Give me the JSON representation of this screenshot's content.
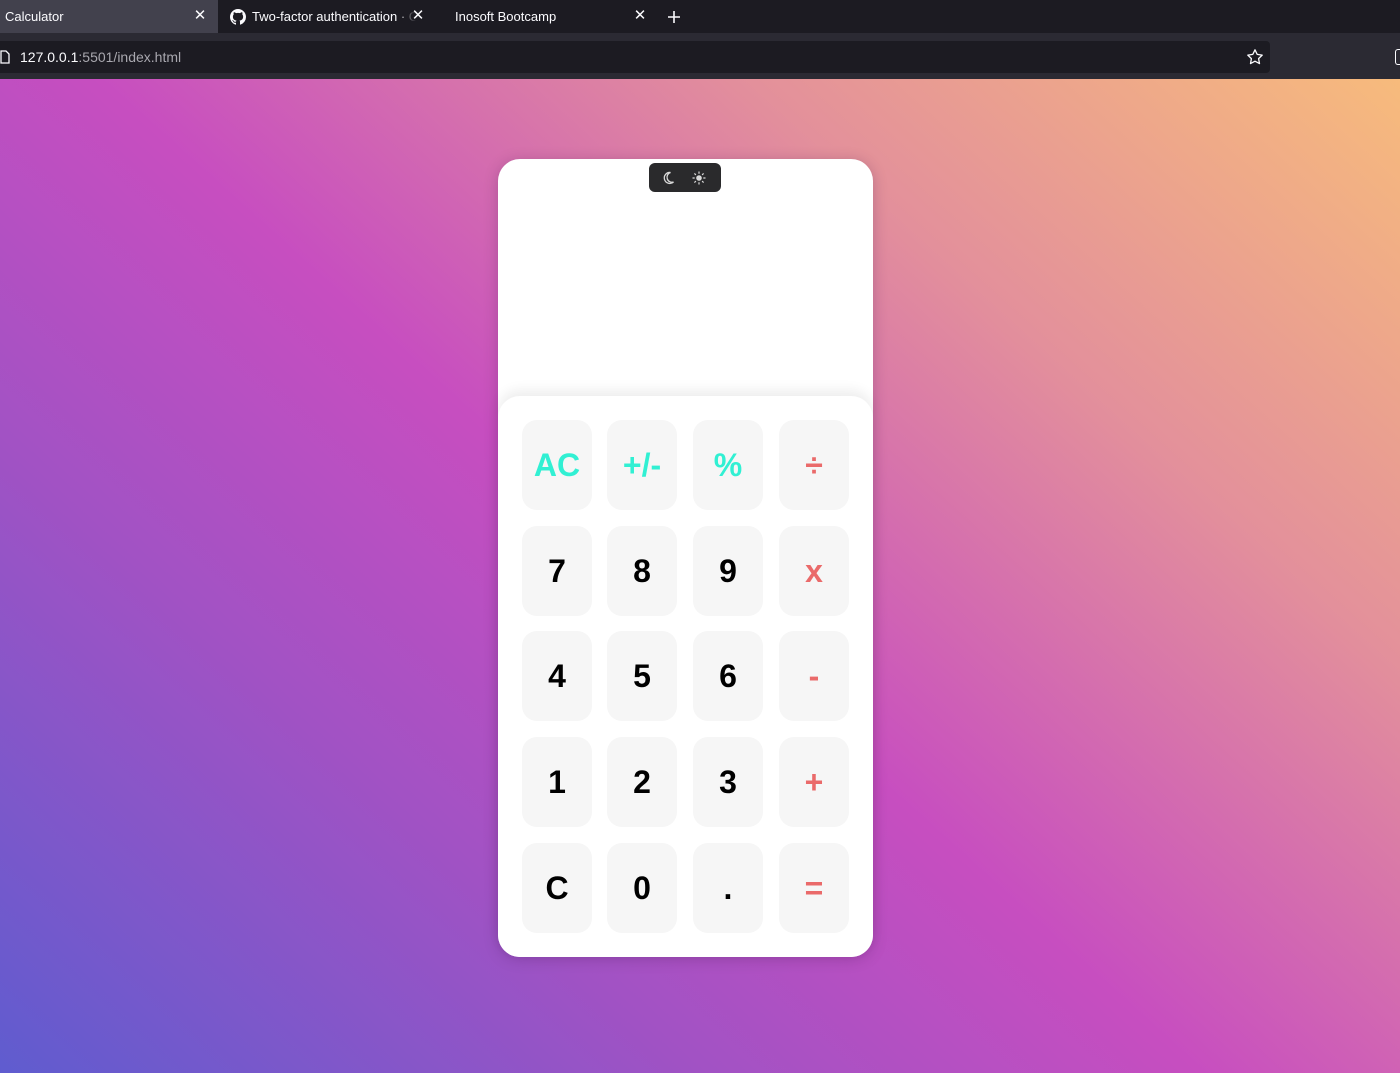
{
  "browser": {
    "tabs": [
      {
        "title": "Calculator",
        "active": true
      },
      {
        "title": "Two-factor authentication · GitHub",
        "active": false,
        "icon": "github-icon"
      },
      {
        "title": "Inosoft Bootcamp",
        "active": false
      }
    ],
    "url": {
      "host": "127.0.0.1",
      "path": ":5501/index.html"
    }
  },
  "calculator": {
    "display_value": "",
    "theme_toggle": {
      "dark_icon": "moon-icon",
      "light_icon": "sun-icon"
    },
    "colors": {
      "function_key": "#31f0d3",
      "operator_key": "#ea6a6a",
      "number_key": "#000000",
      "key_background": "#f6f6f6"
    },
    "keys": {
      "ac": "AC",
      "plus_minus": "+/-",
      "percent": "%",
      "divide": "÷",
      "seven": "7",
      "eight": "8",
      "nine": "9",
      "multiply": "x",
      "four": "4",
      "five": "5",
      "six": "6",
      "subtract": "-",
      "one": "1",
      "two": "2",
      "three": "3",
      "add": "+",
      "clear": "C",
      "zero": "0",
      "decimal": ".",
      "equals": "="
    }
  }
}
